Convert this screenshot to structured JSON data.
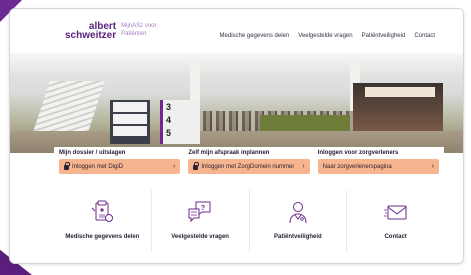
{
  "header": {
    "logo_line1": "albert",
    "logo_line2": "schweitzer",
    "logo_sub1": "MijnASz voor",
    "logo_sub2": "Patiënten",
    "nav": [
      {
        "label": "Medische gegevens delen"
      },
      {
        "label": "Veelgestelde vragen"
      },
      {
        "label": "Patiëntveiligheid"
      },
      {
        "label": "Contact"
      }
    ]
  },
  "hero": {
    "sign_rows": [
      "3",
      "4",
      "5"
    ]
  },
  "actions": [
    {
      "title": "Mijn dossier / uitslagen",
      "button": "Inloggen met DigiD",
      "icon": "lock-icon"
    },
    {
      "title": "Zelf mijn afspraak inplannen",
      "button": "Inloggen met ZorgDomein nummer",
      "icon": "lock-icon"
    },
    {
      "title": "Inloggen voor zorgverleners",
      "button": "Naar zorgverlenerspagina",
      "icon": ""
    }
  ],
  "tiles": [
    {
      "label": "Medische gegevens delen",
      "icon": "medical-records-icon"
    },
    {
      "label": "Veelgestelde vragen",
      "icon": "question-chat-icon"
    },
    {
      "label": "Patiëntveiligheid",
      "icon": "doctor-icon"
    },
    {
      "label": "Contact",
      "icon": "envelope-icon"
    }
  ],
  "colors": {
    "brand_purple": "#5a1f7e",
    "button_peach": "#f7b58f",
    "icon_purple": "#6b2a8f"
  }
}
